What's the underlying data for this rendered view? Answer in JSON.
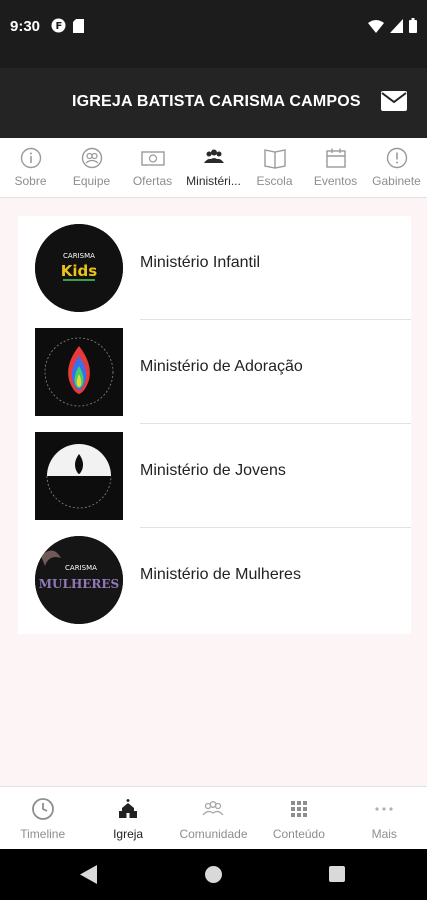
{
  "status": {
    "time": "9:30"
  },
  "header": {
    "title": "IGREJA BATISTA CARISMA CAMPOS"
  },
  "tabs": [
    {
      "label": "Sobre",
      "icon": "info-icon"
    },
    {
      "label": "Equipe",
      "icon": "people-icon"
    },
    {
      "label": "Ofertas",
      "icon": "money-icon"
    },
    {
      "label": "Ministéri...",
      "icon": "group-icon"
    },
    {
      "label": "Escola",
      "icon": "book-icon"
    },
    {
      "label": "Eventos",
      "icon": "calendar-icon"
    },
    {
      "label": "Gabinete",
      "icon": "alert-icon"
    }
  ],
  "ministries": [
    {
      "label": "Ministério Infantil",
      "logo_text": "CARISMA",
      "logo_sub": "Kids"
    },
    {
      "label": "Ministério de Adoração",
      "logo_text": ""
    },
    {
      "label": "Ministério de Jovens",
      "logo_text": ""
    },
    {
      "label": "Ministério de Mulheres",
      "logo_text": "CARISMA",
      "logo_sub": "MULHERES"
    }
  ],
  "bottom_nav": [
    {
      "label": "Timeline",
      "icon": "clock-icon"
    },
    {
      "label": "Igreja",
      "icon": "church-icon"
    },
    {
      "label": "Comunidade",
      "icon": "community-icon"
    },
    {
      "label": "Conteúdo",
      "icon": "grid-icon"
    },
    {
      "label": "Mais",
      "icon": "more-icon"
    }
  ],
  "colors": {
    "appbar": "#242424",
    "status": "#1c1c1c",
    "background": "#fdf5f5",
    "active": "#2a2a2a",
    "inactive": "#8e8e8e"
  }
}
